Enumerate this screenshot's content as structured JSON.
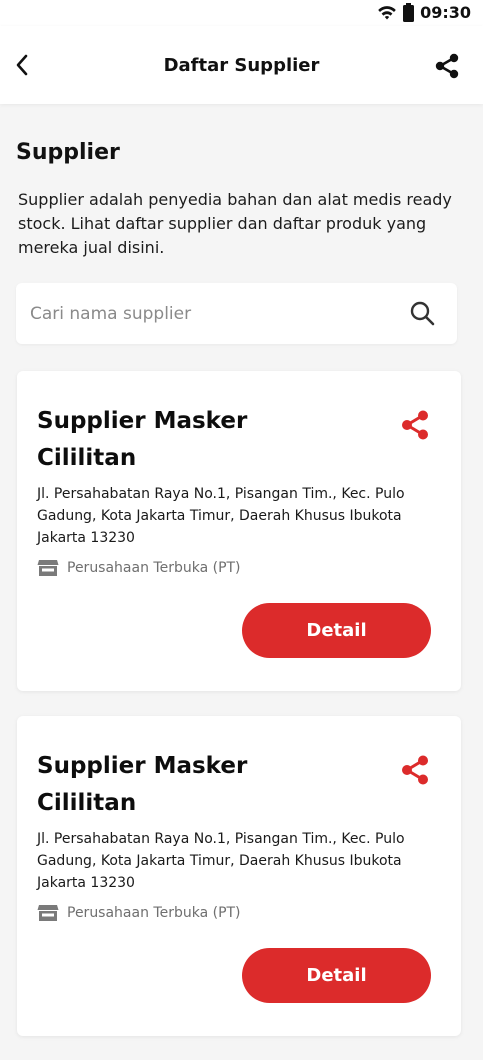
{
  "status_bar": {
    "time": "09:30"
  },
  "header": {
    "title": "Daftar Supplier"
  },
  "intro": {
    "title": "Supplier",
    "description": "Supplier adalah penyedia bahan dan alat medis ready stock. Lihat daftar supplier dan daftar produk yang mereka jual disini."
  },
  "search": {
    "placeholder": "Cari nama supplier"
  },
  "suppliers": [
    {
      "name": "Supplier Masker Cililitan",
      "address": "Jl. Persahabatan Raya No.1, Pisangan Tim., Kec. Pulo Gadung, Kota Jakarta Timur, Daerah Khusus Ibukota Jakarta 13230",
      "type": "Perusahaan Terbuka (PT)",
      "button_label": "Detail"
    },
    {
      "name": "Supplier Masker Cililitan",
      "address": "Jl. Persahabatan Raya No.1, Pisangan Tim., Kec. Pulo Gadung, Kota Jakarta Timur, Daerah Khusus Ibukota Jakarta 13230",
      "type": "Perusahaan Terbuka (PT)",
      "button_label": "Detail"
    }
  ],
  "colors": {
    "accent": "#dc2b2b",
    "background": "#f5f5f5",
    "card": "#ffffff"
  },
  "icons": [
    "wifi-icon",
    "battery-icon",
    "back-arrow-icon",
    "share-icon",
    "search-icon",
    "store-icon"
  ]
}
